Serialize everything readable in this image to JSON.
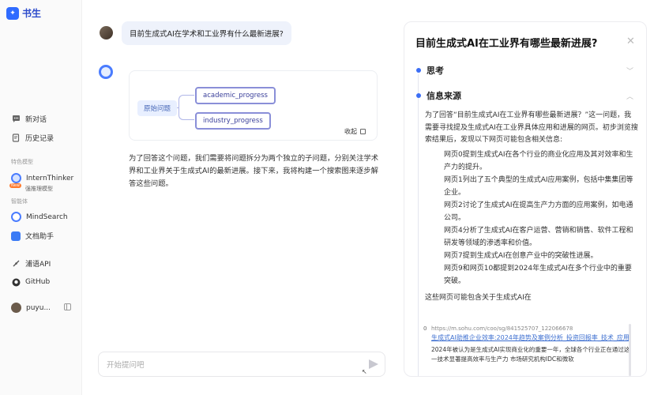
{
  "app": {
    "logo_text": "书生"
  },
  "sidebar": {
    "nav": [
      {
        "label": "新对话",
        "icon": "chat-bubble-icon"
      },
      {
        "label": "历史记录",
        "icon": "history-icon"
      }
    ],
    "section_models": "特色模型",
    "model": {
      "label": "InternThinker",
      "badge": "New",
      "sub": "强推理模型"
    },
    "section_agents": "智能体",
    "agents": [
      {
        "label": "MindSearch"
      },
      {
        "label": "文档助手"
      }
    ],
    "links": [
      {
        "label": "浦语API"
      },
      {
        "label": "GitHub"
      }
    ],
    "user": {
      "name": "puyu..."
    }
  },
  "chat": {
    "user_question": "目前生成式AI在学术和工业界有什么最新进展?",
    "graph": {
      "root": "原始问题",
      "children": [
        "academic_progress",
        "industry_progress"
      ],
      "collapse_label": "收起"
    },
    "answer": "为了回答这个问题，我们需要将问题拆分为两个独立的子问题，分别关注学术界和工业界关于生成式AI的最新进展。接下来，我将构建一个搜索图来逐步解答这些问题。",
    "input_placeholder": "开始提问吧"
  },
  "panel": {
    "title": "目前生成式AI在工业界有哪些最新进展?",
    "sections": [
      "思考",
      "信息来源"
    ],
    "intro": "为了回答“目前生成式AI在工业界有哪些最新进展？”这一问题，我需要寻找提及生成式AI在工业界具体应用和进展的网页。初步浏览搜索结果后，发现以下网页可能包含相关信息:",
    "bullets": [
      "网页0提到生成式AI在各个行业的商业化应用及其对效率和生产力的提升。",
      "网页1列出了五个典型的生成式AI应用案例，包括中集集团等企业。",
      "网页2讨论了生成式AI在提高生产力方面的应用案例，如电通公司。",
      "网页4分析了生成式AI在客户运营、营销和销售、软件工程和研发等领域的渗透率和价值。",
      "网页7提到生成式AI在创意产业中的突破性进展。",
      "网页9和网页10都提到2024年生成式AI在多个行业中的重要突破。"
    ],
    "tail": "这些网页可能包含关于生成式AI在",
    "source": {
      "index": "0",
      "url": "https://m.sohu.com/coo/sg/841525707_122066678",
      "title": "生成式AI助推企业效率:2024年趋势及案例分析_投资回报率_技术_应用",
      "snippet": "2024年被认为是生成式AI实现商业化的重要一年，全球各个行业正在通过这一技术显著提高效率与生产力 市场研究机构IDC和微软"
    }
  }
}
